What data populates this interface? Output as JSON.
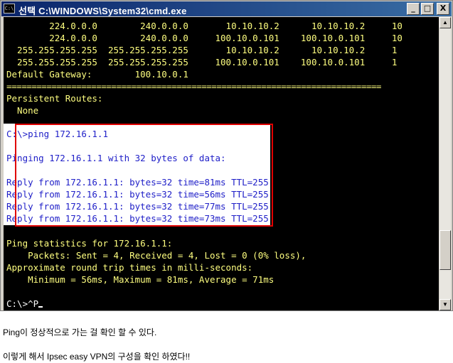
{
  "window": {
    "title": "선택 C:\\WINDOWS\\System32\\cmd.exe",
    "icon_label": "C:\\",
    "minimize_label": "_",
    "maximize_label": "□",
    "close_label": "X"
  },
  "console": {
    "route_lines": [
      "        224.0.0.0        240.0.0.0       10.10.10.2      10.10.10.2     10",
      "        224.0.0.0        240.0.0.0     100.10.0.101    100.10.0.101     10",
      "  255.255.255.255  255.255.255.255       10.10.10.2      10.10.10.2     1",
      "  255.255.255.255  255.255.255.255     100.10.0.101    100.10.0.101     1"
    ],
    "default_gateway": "Default Gateway:        100.10.0.1",
    "separator": "===========================================================================",
    "persistent_routes_label": "Persistent Routes:",
    "persistent_routes_value": "  None",
    "ping_command": "C:\\>ping 172.16.1.1",
    "pinging_line": "Pinging 172.16.1.1 with 32 bytes of data:",
    "reply_lines": [
      "Reply from 172.16.1.1: bytes=32 time=81ms TTL=255",
      "Reply from 172.16.1.1: bytes=32 time=56ms TTL=255",
      "Reply from 172.16.1.1: bytes=32 time=77ms TTL=255",
      "Reply from 172.16.1.1: bytes=32 time=73ms TTL=255"
    ],
    "stats_header": "Ping statistics for 172.16.1.1:",
    "packets_line": "    Packets: Sent = 4, Received = 4, Lost = 0 (0% loss),",
    "approx_line": "Approximate round trip times in milli-seconds:",
    "minmax_line": "    Minimum = 56ms, Maximum = 81ms, Average = 71ms",
    "prompt_line": "C:\\>^P"
  },
  "scrollbar": {
    "up_arrow": "▲",
    "down_arrow": "▼"
  },
  "captions": {
    "line1": "Ping이 정상적으로 가는 걸 확인 할 수 있다.",
    "line2": "이렇게 해서 Ipsec easy VPN의 구성을 확인 하였다!!"
  }
}
